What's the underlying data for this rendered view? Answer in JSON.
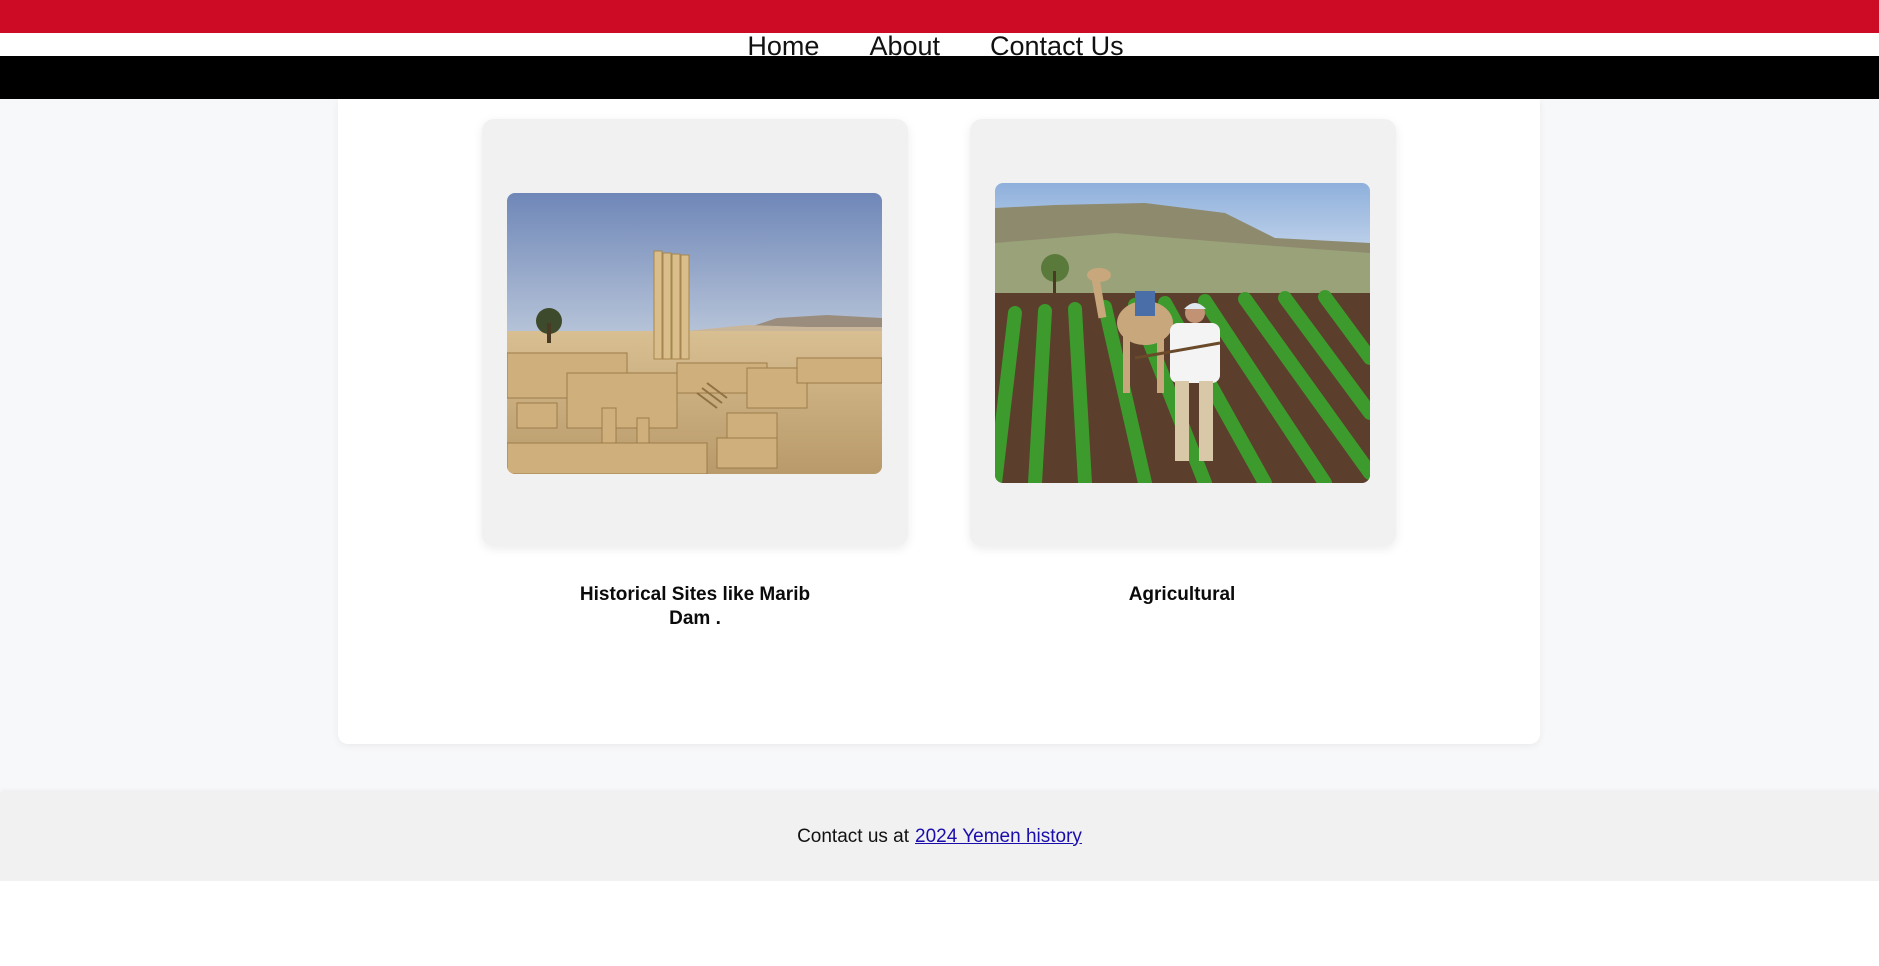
{
  "nav": {
    "items": [
      {
        "label": "Home"
      },
      {
        "label": "About"
      },
      {
        "label": "Contact Us"
      }
    ]
  },
  "cards": [
    {
      "caption": "Historical Sites like Marib Dam .",
      "image": "ancient-temple-ruins-columns"
    },
    {
      "caption": "Agricultural",
      "image": "camel-plowing-field"
    }
  ],
  "footer": {
    "text": "Contact us at",
    "link_text": "2024 Yemen history"
  },
  "colors": {
    "flag_red": "#ce0b24",
    "flag_white": "#ffffff",
    "flag_black": "#000000",
    "link": "#1a0dab"
  }
}
